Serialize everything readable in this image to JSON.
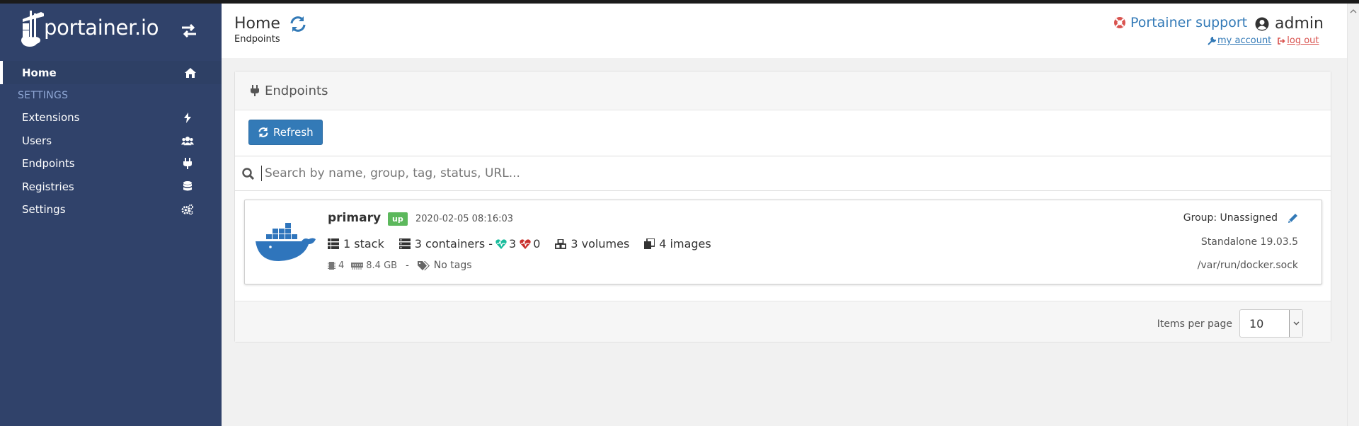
{
  "app": {
    "brand": "portainer.io"
  },
  "sidebar": {
    "home_label": "Home",
    "settings_header": "SETTINGS",
    "items": [
      {
        "label": "Extensions",
        "icon": "bolt-icon"
      },
      {
        "label": "Users",
        "icon": "users-icon"
      },
      {
        "label": "Endpoints",
        "icon": "plug-icon"
      },
      {
        "label": "Registries",
        "icon": "database-icon"
      },
      {
        "label": "Settings",
        "icon": "cogs-icon"
      }
    ]
  },
  "header": {
    "title": "Home",
    "breadcrumb": "Endpoints",
    "support_label": "Portainer support",
    "username": "admin",
    "my_account": "my account",
    "log_out": "log out"
  },
  "widget": {
    "title": "Endpoints",
    "refresh_label": "Refresh",
    "search_placeholder": "Search by name, group, tag, status, URL..."
  },
  "endpoint": {
    "name": "primary",
    "status": "up",
    "timestamp": "2020-02-05 08:16:03",
    "stacks": "1 stack",
    "containers": "3 containers -",
    "healthy": "3",
    "unhealthy": "0",
    "volumes": "3 volumes",
    "images": "4 images",
    "cpu": "4",
    "memory": "8.4 GB",
    "separator": "-",
    "tags": "No tags",
    "group": "Group: Unassigned",
    "engine": "Standalone 19.03.5",
    "url": "/var/run/docker.sock"
  },
  "pagination": {
    "items_per_page_label": "Items per page",
    "items_per_page_value": "10"
  },
  "colors": {
    "sidebar_bg": "#30426a",
    "accent": "#337ab7",
    "status_up": "#5cb85c",
    "healthy": "#1abc9c",
    "unhealthy": "#c9302c",
    "logout": "#d9534f"
  }
}
